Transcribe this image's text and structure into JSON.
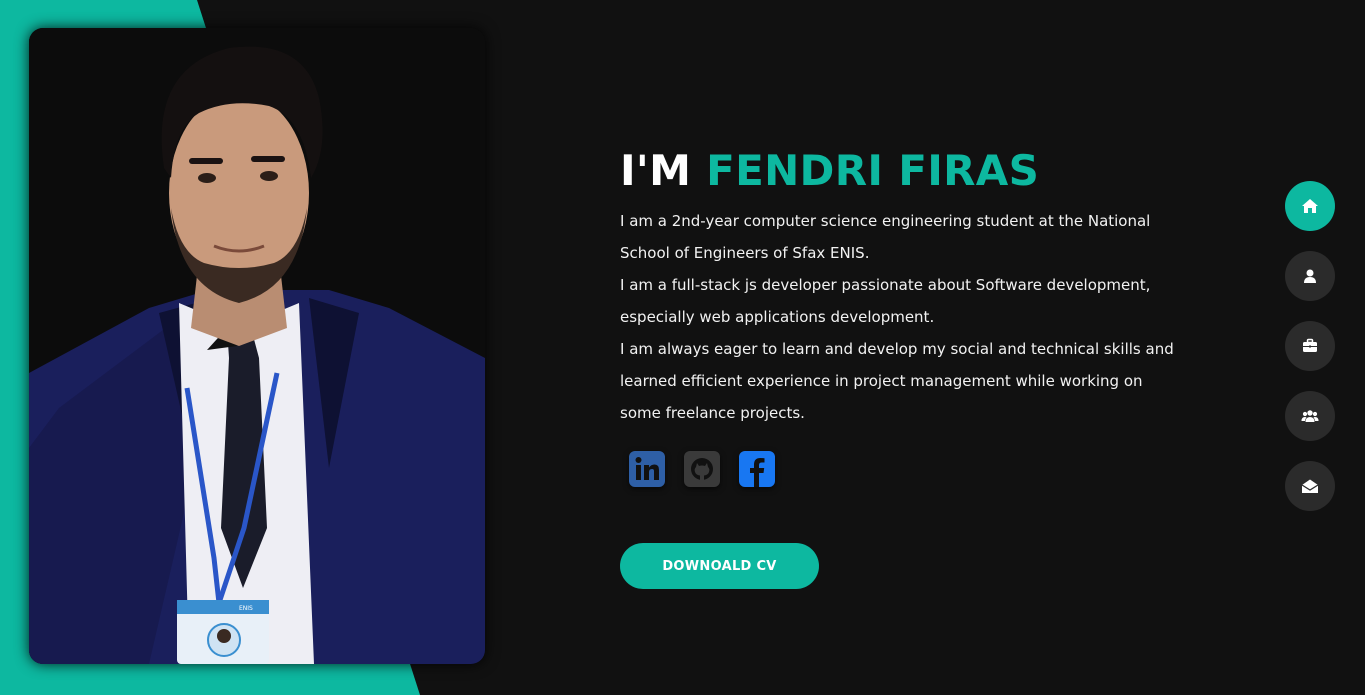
{
  "colors": {
    "accent": "#0db8a0",
    "background": "#111111",
    "nav_button": "#2b2b2b",
    "linkedin": "#2e5fa6",
    "github": "#3a3a3a",
    "facebook": "#1877f2"
  },
  "hero": {
    "title_prefix": "I'M",
    "title_name": "FENDRI FIRAS",
    "bio": [
      "I am a 2nd-year computer science engineering student at the National School of Engineers of Sfax ENIS.",
      "I am a full-stack js developer passionate about Software development, especially web applications development.",
      "I am always eager to learn and develop my social and technical skills and learned efficient experience in project management while working on some freelance projects."
    ],
    "cv_button_label": "DOWNOALD CV"
  },
  "social": [
    {
      "icon": "linkedin-icon"
    },
    {
      "icon": "github-icon"
    },
    {
      "icon": "facebook-icon"
    }
  ],
  "nav": [
    {
      "icon": "home-icon",
      "active": true
    },
    {
      "icon": "user-icon",
      "active": false
    },
    {
      "icon": "briefcase-icon",
      "active": false
    },
    {
      "icon": "users-icon",
      "active": false
    },
    {
      "icon": "envelope-open-icon",
      "active": false
    }
  ],
  "portrait": {
    "badge_text": "ENIS"
  }
}
